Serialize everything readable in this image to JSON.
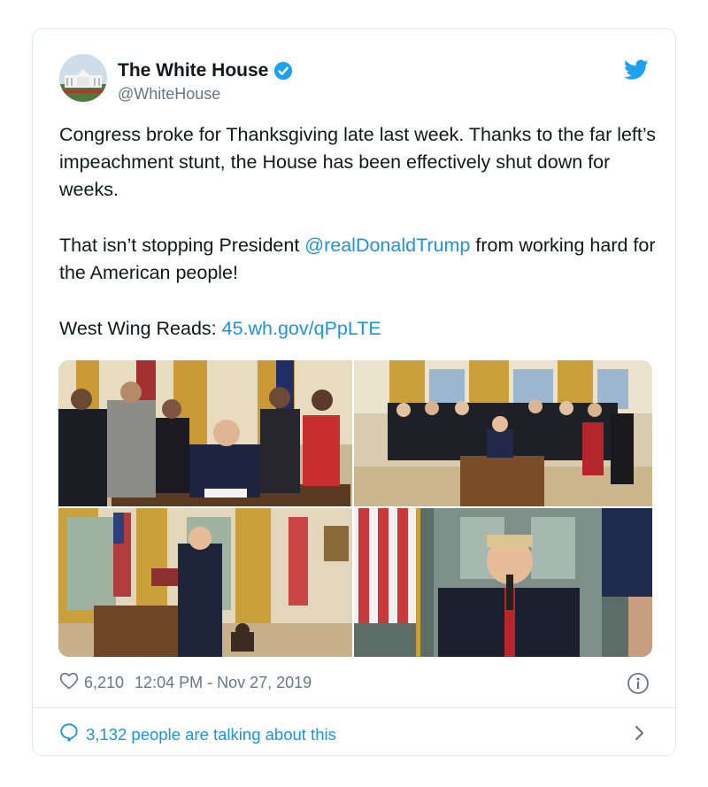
{
  "author": {
    "name": "The White House",
    "handle": "@WhiteHouse",
    "verified": true
  },
  "tweet": {
    "p1": "Congress broke for Thanksgiving late last week. Thanks to the far left’s impeachment stunt, the House has been effectively shut down for weeks.",
    "p2_before": "That isn’t stopping President ",
    "p2_mention": "@realDonaldTrump",
    "p2_after": " from working hard for the American people!",
    "p3_label": "West Wing Reads: ",
    "p3_link": "45.wh.gov/qPpLTE"
  },
  "footer": {
    "likes": "6,210",
    "timestamp": "12:04 PM - Nov 27, 2019",
    "talking": "3,132 people are talking about this"
  },
  "icons": {
    "like": "heart-outline-icon",
    "info": "info-circle-icon",
    "reply": "speech-bubble-icon",
    "brand": "twitter-bird-icon",
    "verified": "verified-badge-icon",
    "more": "chevron-right-icon"
  },
  "colors": {
    "link": "#1b95e0",
    "secondary_text": "#657786",
    "border": "#e1e8ed",
    "verified": "#1da1f2"
  }
}
